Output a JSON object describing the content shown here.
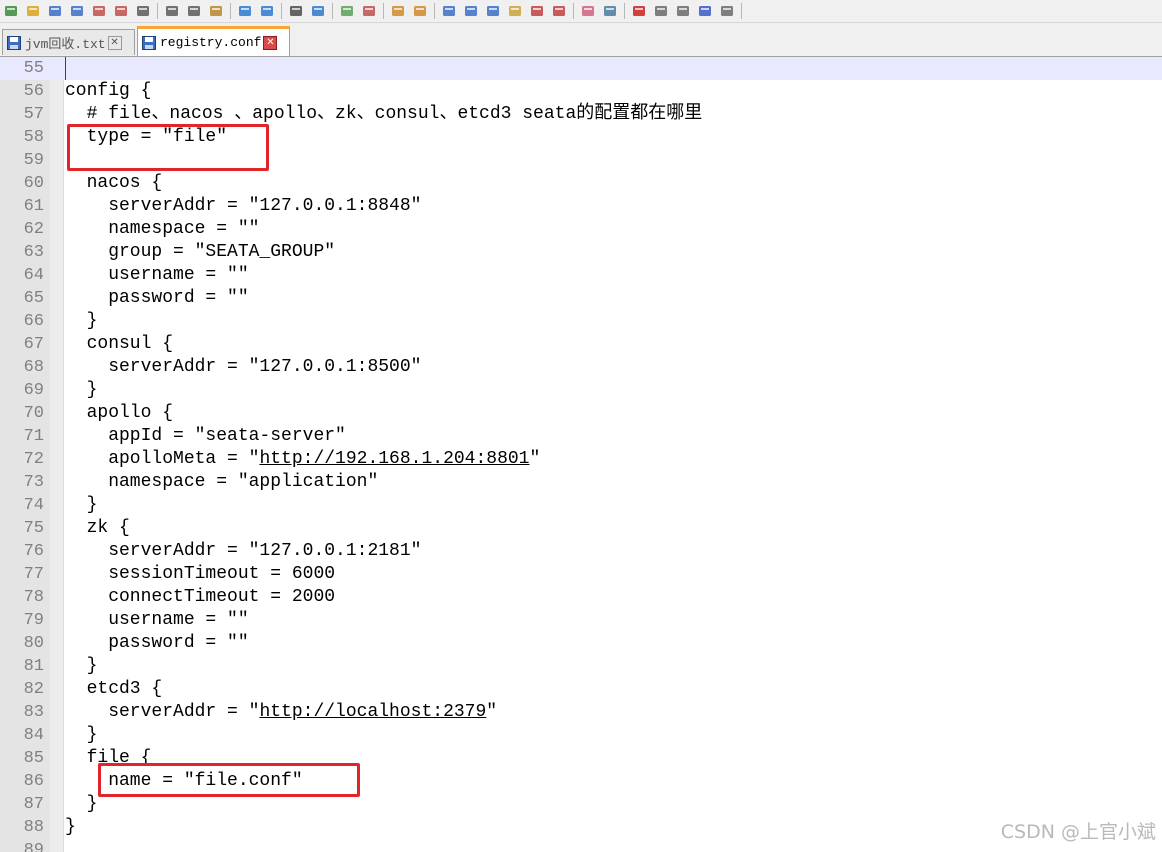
{
  "toolbar": {
    "icons": [
      "new-file",
      "open-file",
      "save",
      "save-all",
      "close",
      "close-all",
      "print",
      "cut",
      "copy",
      "paste",
      "undo",
      "redo",
      "find",
      "replace",
      "zoom-in",
      "zoom-out",
      "sync-vertical",
      "sync-horizontal",
      "word-wrap",
      "show-all-chars",
      "indent-guide",
      "udl",
      "function-list",
      "doc-map",
      "folder-workspace",
      "monitoring",
      "record-macro",
      "stop-macro",
      "play-macro",
      "run-macro-multiple",
      "save-macro"
    ]
  },
  "tabs": [
    {
      "label": "jvm回收.txt",
      "active": false
    },
    {
      "label": "registry.conf",
      "active": true
    }
  ],
  "editor": {
    "lines": [
      {
        "num": "55",
        "text": "",
        "current": true
      },
      {
        "num": "56",
        "text": "config {"
      },
      {
        "num": "57",
        "text": "  # file、nacos 、apollo、zk、consul、etcd3 seata的配置都在哪里"
      },
      {
        "num": "58",
        "text": "  type = \"file\""
      },
      {
        "num": "59",
        "text": ""
      },
      {
        "num": "60",
        "text": "  nacos {"
      },
      {
        "num": "61",
        "text": "    serverAddr = \"127.0.0.1:8848\""
      },
      {
        "num": "62",
        "text": "    namespace = \"\""
      },
      {
        "num": "63",
        "text": "    group = \"SEATA_GROUP\""
      },
      {
        "num": "64",
        "text": "    username = \"\""
      },
      {
        "num": "65",
        "text": "    password = \"\""
      },
      {
        "num": "66",
        "text": "  }"
      },
      {
        "num": "67",
        "text": "  consul {"
      },
      {
        "num": "68",
        "text": "    serverAddr = \"127.0.0.1:8500\""
      },
      {
        "num": "69",
        "text": "  }"
      },
      {
        "num": "70",
        "text": "  apollo {"
      },
      {
        "num": "71",
        "text": "    appId = \"seata-server\""
      },
      {
        "num": "72",
        "pre": "    apolloMeta = \"",
        "url": "http://192.168.1.204:8801",
        "post": "\""
      },
      {
        "num": "73",
        "text": "    namespace = \"application\""
      },
      {
        "num": "74",
        "text": "  }"
      },
      {
        "num": "75",
        "text": "  zk {"
      },
      {
        "num": "76",
        "text": "    serverAddr = \"127.0.0.1:2181\""
      },
      {
        "num": "77",
        "text": "    sessionTimeout = 6000"
      },
      {
        "num": "78",
        "text": "    connectTimeout = 2000"
      },
      {
        "num": "79",
        "text": "    username = \"\""
      },
      {
        "num": "80",
        "text": "    password = \"\""
      },
      {
        "num": "81",
        "text": "  }"
      },
      {
        "num": "82",
        "text": "  etcd3 {"
      },
      {
        "num": "83",
        "pre": "    serverAddr = \"",
        "url": "http://localhost:2379",
        "post": "\""
      },
      {
        "num": "84",
        "text": "  }"
      },
      {
        "num": "85",
        "text": "  file {"
      },
      {
        "num": "86",
        "text": "    name = \"file.conf\""
      },
      {
        "num": "87",
        "text": "  }"
      },
      {
        "num": "88",
        "text": "}"
      },
      {
        "num": "89",
        "text": ""
      }
    ]
  },
  "watermark": "CSDN @上官小斌",
  "colors": {
    "highlight_box": "#e0262b",
    "current_line": "#e8e8ff",
    "line_number": "#808080",
    "active_tab_accent": "#f6a632"
  }
}
